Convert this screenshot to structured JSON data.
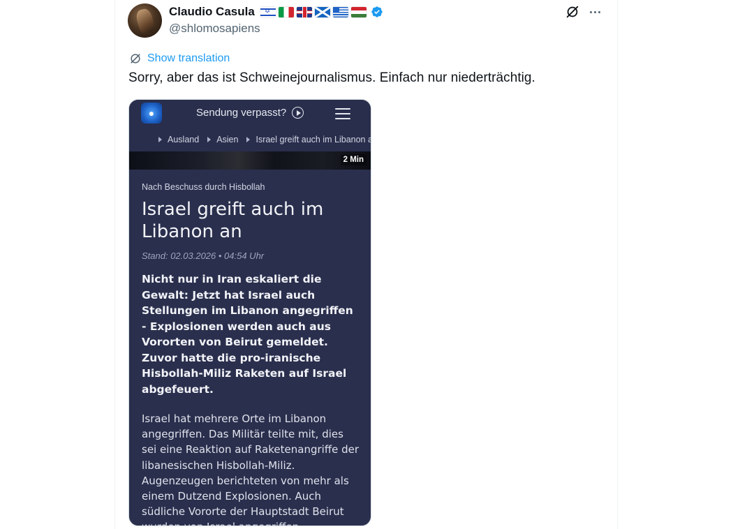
{
  "tweet": {
    "display_name": "Claudio Casula",
    "handle": "@shlomosapiens",
    "flags": [
      "israel-flag",
      "italy-flag",
      "uk-flag",
      "scotland-flag",
      "greece-flag",
      "hungary-flag"
    ],
    "verified": true,
    "show_translation": "Show translation",
    "text": "Sorry, aber das ist Schweinejournalismus. Einfach nur niederträchtig.",
    "accent_color": "#1d9bf0"
  },
  "media": {
    "nav": {
      "sendung": "Sendung verpasst?"
    },
    "breadcrumbs": [
      "Ausland",
      "Asien",
      "Israel greift auch im Libanon an"
    ],
    "duration": "2 Min",
    "kicker": "Nach Beschuss durch Hisbollah",
    "headline": "Israel greift auch im Libanon an",
    "stand": "Stand: 02.03.2026 • 04:54 Uhr",
    "teaser": "Nicht nur in Iran eskaliert die Gewalt: Jetzt hat Israel auch Stellungen im Libanon angegriffen - Explosionen werden auch aus Vororten von Beirut gemeldet. Zuvor hatte die pro-iranische Hisbollah-Miliz Raketen auf Israel abgefeuert.",
    "body": "Israel hat mehrere Orte im Libanon angegriffen. Das Militär teilte mit, dies sei eine Reaktion auf Raketenangriffe der libanesischen Hisbollah-Miliz. Augenzeugen berichteten von mehr als einem Dutzend Explosionen. Auch südliche Vororte der Hauptstadt Beirut wurden von Israel angegriffen.",
    "background_color": "#2a2f4d"
  }
}
